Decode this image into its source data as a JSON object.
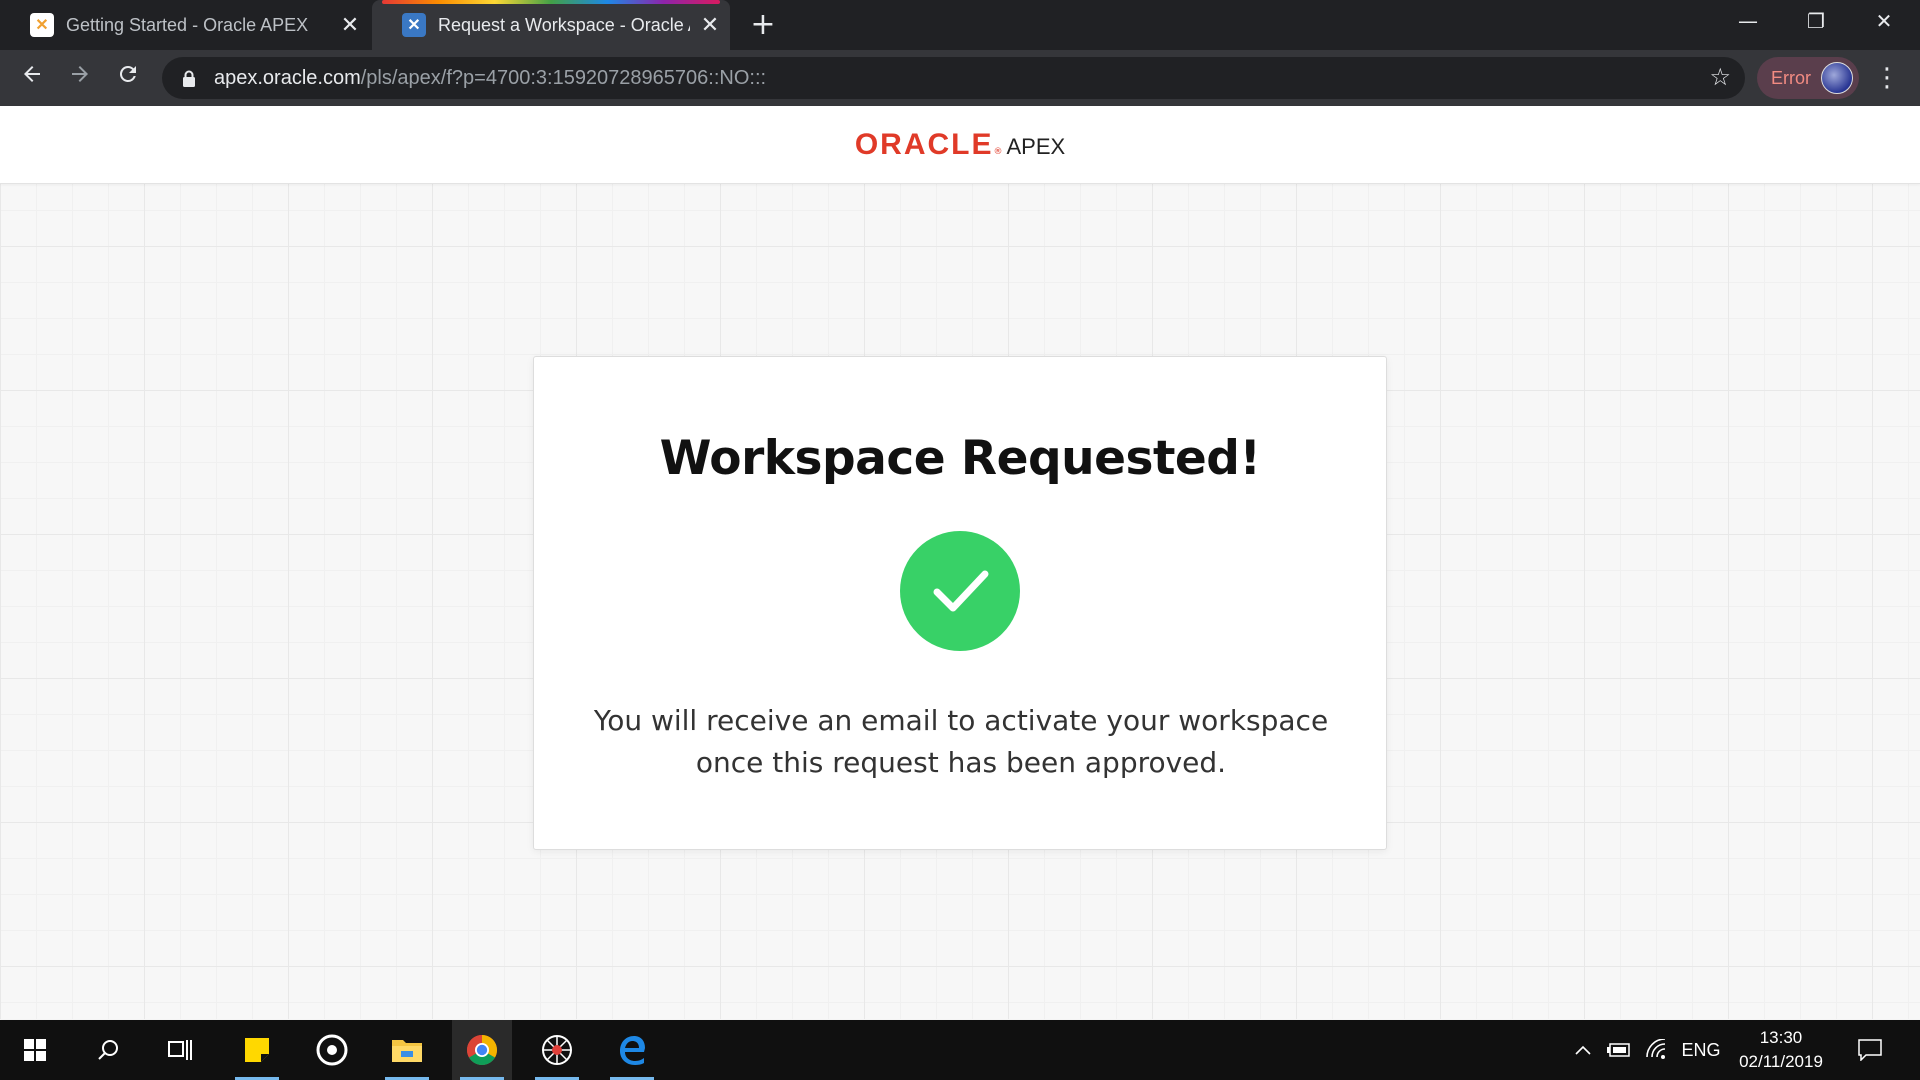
{
  "browser": {
    "tabs": [
      {
        "title": "Getting Started - Oracle APEX",
        "close": "✕"
      },
      {
        "title": "Request a Workspace - Oracle Ap",
        "close": "✕"
      }
    ],
    "new_tab": "+",
    "window_controls": {
      "minimize": "—",
      "restore": "❐",
      "close": "✕"
    },
    "url_host": "apex.oracle.com",
    "url_path": "/pls/apex/f?p=4700:3:15920728965706::NO:::",
    "profile_label": "Error",
    "icons": {
      "back": "back-arrow-icon",
      "forward": "forward-arrow-icon",
      "reload": "reload-icon",
      "lock": "lock-icon",
      "star": "bookmark-star-icon",
      "menu": "kebab-menu-icon"
    }
  },
  "header": {
    "logo_oracle": "ORACLE",
    "logo_reg": "®",
    "logo_apex": "APEX"
  },
  "card": {
    "title": "Workspace Requested!",
    "message_line1": "You will receive an email to activate your workspace",
    "message_line2": "once this request has been approved.",
    "check_color": "#38d167"
  },
  "taskbar": {
    "language": "ENG",
    "time": "13:30",
    "date": "02/11/2019",
    "apps": [
      "start",
      "search",
      "task-view",
      "sticky-notes",
      "app-circle",
      "file-explorer",
      "chrome",
      "web-app",
      "edge"
    ]
  },
  "colors": {
    "brand_red": "#e03a28",
    "profile_error": "#f28b82",
    "taskbar": "#101010"
  }
}
